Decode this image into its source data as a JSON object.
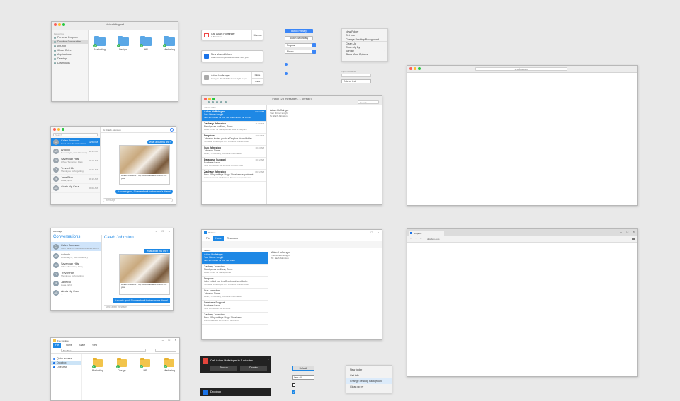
{
  "finder": {
    "title": "Heinz Klingbeil",
    "sidebar_heading": "Favourites",
    "sidebar": [
      "Personal Dropbox",
      "Dropbox Corporation",
      "AirDrop",
      "iCloud Drive",
      "Applications",
      "Desktop",
      "Downloads"
    ],
    "folders": [
      "Marketing",
      "Design",
      "HR",
      "Marketing"
    ]
  },
  "messages_mac": {
    "search": "Search",
    "to": "To: Caleb Johnston",
    "conversations": [
      {
        "initials": "CJ",
        "name": "Caleb Johnston",
        "time": "12:54 PM",
        "preview": "Can I have the instructions as a Pasta Grandma?"
      },
      {
        "initials": "AN",
        "name": "Antonio",
        "time": "11:12 AM",
        "preview": "Rosemary's, Toss Rosemary Rosemary Amaroni"
      },
      {
        "initials": "SH",
        "name": "Savannah Hills",
        "time": "11:13 AM",
        "preview": "Wheel Tomorrow, Pisiq"
      },
      {
        "initials": "TH",
        "name": "Trevor Hills",
        "time": "10:25 AM",
        "preview": "Thank you for forgetting"
      },
      {
        "initials": "JB",
        "name": "Jane Blue",
        "time": "09:12 AM",
        "preview": "Haha, right!"
      },
      {
        "initials": "AG",
        "name": "Alexis Ng Cruz",
        "time": "09:05 AM",
        "preview": "..."
      }
    ],
    "bubble_top": "What about this one?",
    "card_title": "Dinner in Roma - Top 10 Restaurants to visit this year",
    "card_source": "by Food Dunn",
    "bubble_bottom": "It sounds good, I'll remember it for tomorrow's dinner!",
    "compose": "iMessage"
  },
  "messages_win": {
    "app": "iMessage",
    "header": "Conversations",
    "contact": "Caleb Johnston",
    "conversations": [
      {
        "initials": "CJ",
        "name": "Caleb Johnston",
        "preview": "Can I have the instructions as a Pasta Grandma?"
      },
      {
        "initials": "AN",
        "name": "Antonio",
        "preview": "Rosemary's, Toss Rosemary"
      },
      {
        "initials": "SH",
        "name": "Savannah Hills",
        "preview": "Wheel Tomorrow, Pisiq"
      },
      {
        "initials": "TH",
        "name": "Trevor Hills",
        "preview": "Thank you for forgetting"
      },
      {
        "initials": "JB",
        "name": "Jane Bo",
        "preview": "Haha, right!"
      },
      {
        "initials": "AG",
        "name": "Alexis Ng Cruz",
        "preview": "..."
      }
    ],
    "bubble_top": "What about this one?",
    "card_title": "Dinner in Roma - Top 10 Restaurants to visit this year",
    "card_source": "by Food Dunn",
    "bubble_bottom": "It sounds good, I'll remember it for tomorrow's dinner!",
    "compose": "Send a text message"
  },
  "notifs_mac": [
    {
      "title": "Call Adam Hoffsinger",
      "body": "in 5 minutes",
      "button": "Dismiss"
    },
    {
      "title": "New shared folder",
      "body": "Adam Hoffsinger shared folder with you",
      "button": ""
    },
    {
      "title": "Adam Hoffsinger",
      "body": "Can you check if this looks right to you",
      "button": "Close"
    }
  ],
  "notif_mac_extra_button": "Show",
  "mail_mac": {
    "title": "Inbox (23 messages, 1 unread)",
    "search": "Search",
    "sort": "Sort by Date",
    "items": [
      {
        "from": "Adam Hoffsinger",
        "time": "12:34 PM",
        "subject": "Your Dinner tonight",
        "preview": "I am so excited for this new book about the dinner"
      },
      {
        "from": "Zachary Johnston",
        "time": "11:09 AM",
        "subject": "Fixed prices for Iliana, Rome",
        "preview": "Fixed prices for Iliana, Rome. Like is the price"
      },
      {
        "from": "Dropbox",
        "time": "10:54 AM",
        "subject": "Johnston invited you to a Dropbox shared folder",
        "preview": "Johnston invited you to a Dropbox shared folder"
      },
      {
        "from": "Sun Johnston",
        "time": "10:43 AM",
        "subject": "Johnston Dinner",
        "preview": "Hello, I'm sending you some information"
      },
      {
        "from": "Database Support",
        "time": "10:12 AM",
        "subject": "Purchase Issue",
        "preview": "New connection for 10.0.0.1 on port 5432"
      },
      {
        "from": "Zachary Johnston",
        "time": "09:32 AM",
        "subject": "New - Why settings Stage 1 business experiment",
        "preview": "Announcement 2016 Brazil business experiments"
      }
    ],
    "detail_from": "Adam Hoffsinger",
    "detail_subject": "Your Dinner tonight",
    "detail_to": "To: Zach Johnston"
  },
  "mail_win": {
    "title": "Outlook",
    "tabs": [
      "File",
      "Home",
      "Resources"
    ],
    "folder": "INBOX",
    "items": [
      {
        "from": "Adam Hoffsinger",
        "subject": "Your Dinner tonight",
        "preview": "I am so excited for this new book"
      },
      {
        "from": "Zachary Johnston",
        "subject": "Fixed prices for Iliana, Rome",
        "preview": "Fixed prices for Iliana, Rome"
      },
      {
        "from": "Dropbox",
        "subject": "John invited you to a Dropbox shared folder",
        "preview": "Johnston invited you to a Dropbox shared folder"
      },
      {
        "from": "Sun Johnston",
        "subject": "Johnston Dinner",
        "preview": "Hello, I'm sending you some information"
      },
      {
        "from": "Database Support",
        "subject": "Purchase Issue",
        "preview": "New connection for 10.0.0.1"
      },
      {
        "from": "Zachary Johnston",
        "subject": "New - Why settings Stage 1 business",
        "preview": "Announcement 2016 Brazil business"
      }
    ],
    "detail_from": "Adam Hoffsinger",
    "detail_subject": "Your Dinner tonight",
    "detail_to": "To: Zach Johnston"
  },
  "mac_controls": {
    "button": "Button Primary",
    "button2": "Button Secondary",
    "select1": "Regular",
    "select2": "Phone"
  },
  "context_menu_mac": {
    "items": [
      "New Folder",
      "Get Info",
      "Change Desktop Background...",
      "Clean Up",
      "Clean Up By",
      "Sort By",
      "Show View Options"
    ],
    "field_label": "Input field label",
    "field_value": "Entered text"
  },
  "browser_mac": {
    "url": "dropbox.com"
  },
  "browser_win": {
    "tab": "Dropbox",
    "url": "dropbox.com"
  },
  "explorer": {
    "title": "File Explorer",
    "tabs": [
      "File",
      "Home",
      "Share",
      "View"
    ],
    "path": "Dropbox",
    "sidebar": [
      "Quick access",
      "Dropbox",
      "OneDrive"
    ],
    "folders": [
      "Marketing",
      "Design",
      "HR",
      "Marketing"
    ]
  },
  "toast_win": {
    "title": "Call Adam Hoffsinger in 5 minutes",
    "buttons": [
      "Snooze",
      "Dismiss"
    ],
    "title2": "Dropbox"
  },
  "win_controls": {
    "button": "Default",
    "select": "Item all"
  },
  "context_menu_win": {
    "items": [
      "New folder",
      "Get info",
      "Change desktop background",
      "Clean up by"
    ]
  }
}
